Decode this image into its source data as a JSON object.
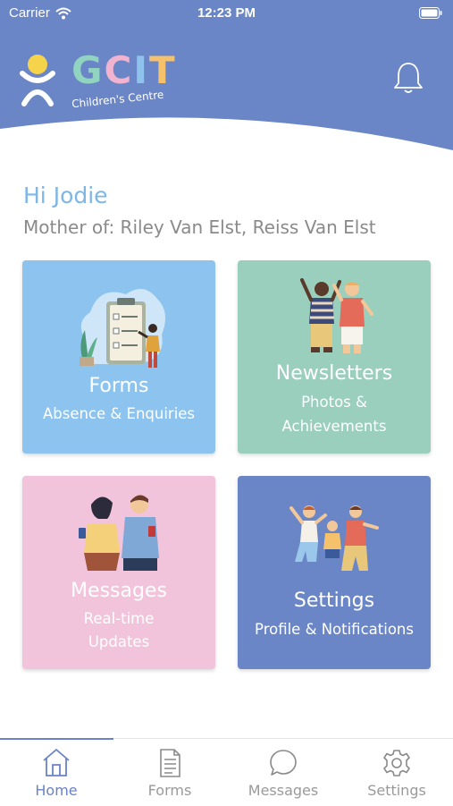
{
  "status_bar": {
    "carrier": "Carrier",
    "time": "12:23 PM"
  },
  "brand": {
    "letters": [
      {
        "char": "G",
        "color": "#8fd3c0"
      },
      {
        "char": "C",
        "color": "#f0b3d0"
      },
      {
        "char": "I",
        "color": "#8fc3ee"
      },
      {
        "char": "T",
        "color": "#f5c26b"
      }
    ],
    "tagline": "Children's Centre"
  },
  "header": {
    "icon": "bell-icon",
    "background": "#6b86c6"
  },
  "greeting": "Hi Jodie",
  "parent_of": "Mother of: Riley Van Elst, Reiss Van Elst",
  "tiles": [
    {
      "title": "Forms",
      "subtitle_lines": [
        "Absence & Enquiries"
      ],
      "color": "#8cc4ef"
    },
    {
      "title": "Newsletters",
      "subtitle_lines": [
        "Photos &",
        "Achievements"
      ],
      "color": "#9bcfbd"
    },
    {
      "title": "Messages",
      "subtitle_lines": [
        "Real-time",
        "Updates"
      ],
      "color": "#f2c4db"
    },
    {
      "title": "Settings",
      "subtitle_lines": [
        "Profile & Notifications"
      ],
      "color": "#6b86c6"
    }
  ],
  "tab_bar": {
    "active": "Home",
    "tabs": [
      {
        "label": "Home",
        "icon": "home-icon"
      },
      {
        "label": "Forms",
        "icon": "document-icon"
      },
      {
        "label": "Messages",
        "icon": "chat-bubble-icon"
      },
      {
        "label": "Settings",
        "icon": "gear-icon"
      }
    ]
  }
}
